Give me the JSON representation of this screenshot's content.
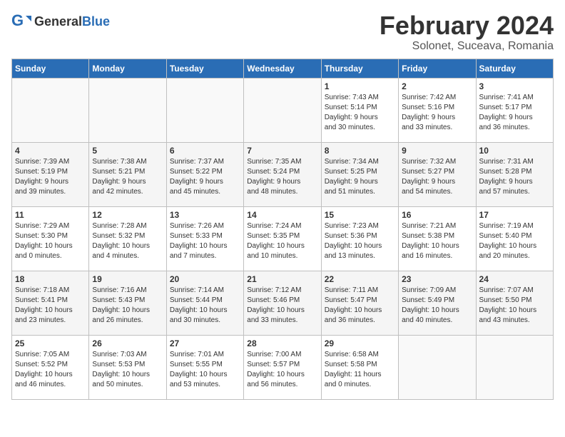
{
  "header": {
    "logo_general": "General",
    "logo_blue": "Blue",
    "month_title": "February 2024",
    "subtitle": "Solonet, Suceava, Romania"
  },
  "days_of_week": [
    "Sunday",
    "Monday",
    "Tuesday",
    "Wednesday",
    "Thursday",
    "Friday",
    "Saturday"
  ],
  "weeks": [
    [
      {
        "day": "",
        "info": ""
      },
      {
        "day": "",
        "info": ""
      },
      {
        "day": "",
        "info": ""
      },
      {
        "day": "",
        "info": ""
      },
      {
        "day": "1",
        "info": "Sunrise: 7:43 AM\nSunset: 5:14 PM\nDaylight: 9 hours\nand 30 minutes."
      },
      {
        "day": "2",
        "info": "Sunrise: 7:42 AM\nSunset: 5:16 PM\nDaylight: 9 hours\nand 33 minutes."
      },
      {
        "day": "3",
        "info": "Sunrise: 7:41 AM\nSunset: 5:17 PM\nDaylight: 9 hours\nand 36 minutes."
      }
    ],
    [
      {
        "day": "4",
        "info": "Sunrise: 7:39 AM\nSunset: 5:19 PM\nDaylight: 9 hours\nand 39 minutes."
      },
      {
        "day": "5",
        "info": "Sunrise: 7:38 AM\nSunset: 5:21 PM\nDaylight: 9 hours\nand 42 minutes."
      },
      {
        "day": "6",
        "info": "Sunrise: 7:37 AM\nSunset: 5:22 PM\nDaylight: 9 hours\nand 45 minutes."
      },
      {
        "day": "7",
        "info": "Sunrise: 7:35 AM\nSunset: 5:24 PM\nDaylight: 9 hours\nand 48 minutes."
      },
      {
        "day": "8",
        "info": "Sunrise: 7:34 AM\nSunset: 5:25 PM\nDaylight: 9 hours\nand 51 minutes."
      },
      {
        "day": "9",
        "info": "Sunrise: 7:32 AM\nSunset: 5:27 PM\nDaylight: 9 hours\nand 54 minutes."
      },
      {
        "day": "10",
        "info": "Sunrise: 7:31 AM\nSunset: 5:28 PM\nDaylight: 9 hours\nand 57 minutes."
      }
    ],
    [
      {
        "day": "11",
        "info": "Sunrise: 7:29 AM\nSunset: 5:30 PM\nDaylight: 10 hours\nand 0 minutes."
      },
      {
        "day": "12",
        "info": "Sunrise: 7:28 AM\nSunset: 5:32 PM\nDaylight: 10 hours\nand 4 minutes."
      },
      {
        "day": "13",
        "info": "Sunrise: 7:26 AM\nSunset: 5:33 PM\nDaylight: 10 hours\nand 7 minutes."
      },
      {
        "day": "14",
        "info": "Sunrise: 7:24 AM\nSunset: 5:35 PM\nDaylight: 10 hours\nand 10 minutes."
      },
      {
        "day": "15",
        "info": "Sunrise: 7:23 AM\nSunset: 5:36 PM\nDaylight: 10 hours\nand 13 minutes."
      },
      {
        "day": "16",
        "info": "Sunrise: 7:21 AM\nSunset: 5:38 PM\nDaylight: 10 hours\nand 16 minutes."
      },
      {
        "day": "17",
        "info": "Sunrise: 7:19 AM\nSunset: 5:40 PM\nDaylight: 10 hours\nand 20 minutes."
      }
    ],
    [
      {
        "day": "18",
        "info": "Sunrise: 7:18 AM\nSunset: 5:41 PM\nDaylight: 10 hours\nand 23 minutes."
      },
      {
        "day": "19",
        "info": "Sunrise: 7:16 AM\nSunset: 5:43 PM\nDaylight: 10 hours\nand 26 minutes."
      },
      {
        "day": "20",
        "info": "Sunrise: 7:14 AM\nSunset: 5:44 PM\nDaylight: 10 hours\nand 30 minutes."
      },
      {
        "day": "21",
        "info": "Sunrise: 7:12 AM\nSunset: 5:46 PM\nDaylight: 10 hours\nand 33 minutes."
      },
      {
        "day": "22",
        "info": "Sunrise: 7:11 AM\nSunset: 5:47 PM\nDaylight: 10 hours\nand 36 minutes."
      },
      {
        "day": "23",
        "info": "Sunrise: 7:09 AM\nSunset: 5:49 PM\nDaylight: 10 hours\nand 40 minutes."
      },
      {
        "day": "24",
        "info": "Sunrise: 7:07 AM\nSunset: 5:50 PM\nDaylight: 10 hours\nand 43 minutes."
      }
    ],
    [
      {
        "day": "25",
        "info": "Sunrise: 7:05 AM\nSunset: 5:52 PM\nDaylight: 10 hours\nand 46 minutes."
      },
      {
        "day": "26",
        "info": "Sunrise: 7:03 AM\nSunset: 5:53 PM\nDaylight: 10 hours\nand 50 minutes."
      },
      {
        "day": "27",
        "info": "Sunrise: 7:01 AM\nSunset: 5:55 PM\nDaylight: 10 hours\nand 53 minutes."
      },
      {
        "day": "28",
        "info": "Sunrise: 7:00 AM\nSunset: 5:57 PM\nDaylight: 10 hours\nand 56 minutes."
      },
      {
        "day": "29",
        "info": "Sunrise: 6:58 AM\nSunset: 5:58 PM\nDaylight: 11 hours\nand 0 minutes."
      },
      {
        "day": "",
        "info": ""
      },
      {
        "day": "",
        "info": ""
      }
    ]
  ]
}
